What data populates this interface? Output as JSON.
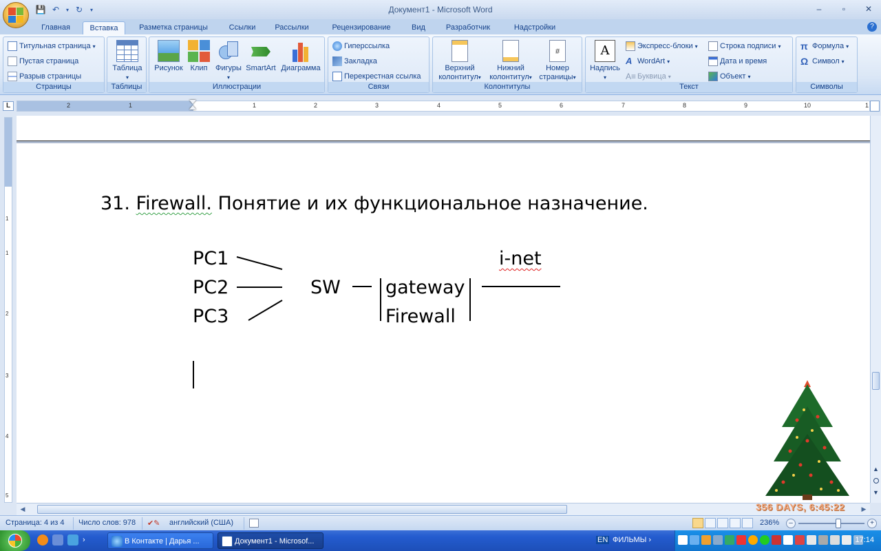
{
  "window": {
    "title": "Документ1 - Microsoft Word",
    "controls": [
      "–",
      "▫",
      "✕"
    ]
  },
  "tabs": [
    "Главная",
    "Вставка",
    "Разметка страницы",
    "Ссылки",
    "Рассылки",
    "Рецензирование",
    "Вид",
    "Разработчик",
    "Надстройки"
  ],
  "active_tab": "Вставка",
  "ribbon": {
    "pages": {
      "label": "Страницы",
      "cover": "Титульная страница",
      "blank": "Пустая страница",
      "break": "Разрыв страницы"
    },
    "tables": {
      "label": "Таблицы",
      "table": "Таблица"
    },
    "illustrations": {
      "label": "Иллюстрации",
      "picture": "Рисунок",
      "clip": "Клип",
      "shapes": "Фигуры",
      "smartart": "SmartArt",
      "chart": "Диаграмма"
    },
    "links": {
      "label": "Связи",
      "hyperlink": "Гиперссылка",
      "bookmark": "Закладка",
      "crossref": "Перекрестная ссылка"
    },
    "headerfooter": {
      "label": "Колонтитулы",
      "header_1": "Верхний",
      "header_2": "колонтитул",
      "footer_1": "Нижний",
      "footer_2": "колонтитул",
      "pagenum_1": "Номер",
      "pagenum_2": "страницы"
    },
    "text": {
      "label": "Текст",
      "textbox": "Надпись",
      "quickparts": "Экспресс-блоки",
      "wordart": "WordArt",
      "dropcap": "Буквица",
      "signature": "Строка подписи",
      "datetime": "Дата и время",
      "object": "Объект"
    },
    "symbols": {
      "label": "Символы",
      "equation": "Формула",
      "symbol": "Символ"
    }
  },
  "ruler": {
    "corner": "L",
    "numbers": [
      "2",
      "1",
      "1",
      "1",
      "2",
      "3",
      "4",
      "5",
      "6",
      "7",
      "8",
      "9",
      "10",
      "1"
    ]
  },
  "vruler_numbers": [
    "1",
    "1",
    "2",
    "3",
    "4",
    "5"
  ],
  "document": {
    "heading_num": "31.",
    "heading_word": "Firewall.",
    "heading_rest": "Понятие и их функциональное назначение.",
    "diagram": {
      "pc1": "PC1",
      "pc2": "PC2",
      "pc3": "PC3",
      "sw": "SW",
      "gateway": "gateway",
      "firewall": "Firewall",
      "inet": "i-net"
    }
  },
  "status": {
    "page": "Страница: 4 из 4",
    "words": "Число слов: 978",
    "language": "английский (США)",
    "zoom": "236%"
  },
  "taskbar": {
    "tasks": [
      "В Контакте | Дарья ...",
      "Документ1 - Microsof..."
    ],
    "lang": "EN",
    "films": "ФИЛЬМЫ",
    "clock": "17:14"
  },
  "overlay": {
    "tree_text": "356 DAYS, 6:45:22"
  },
  "colors": {
    "accent": "#15428b",
    "ribbon": "#dbe7f6",
    "taskbar": "#245ccf",
    "wavy_green": "#3aa24a",
    "wavy_red": "#e02020"
  }
}
